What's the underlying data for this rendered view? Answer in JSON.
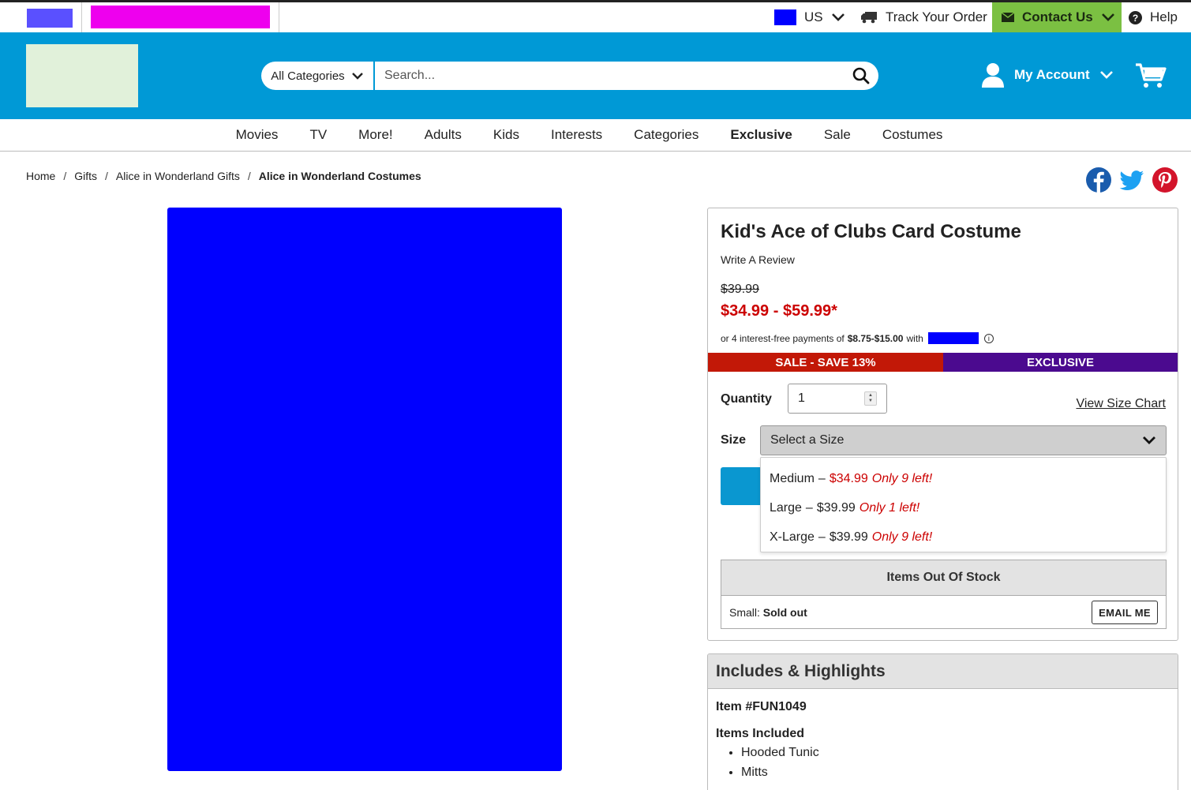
{
  "topbar": {
    "region": "US",
    "track_order": "Track Your Order",
    "contact": "Contact Us",
    "help": "Help"
  },
  "header": {
    "category_select": "All Categories",
    "search_placeholder": "Search...",
    "account": "My Account"
  },
  "nav": {
    "items": [
      "Movies",
      "TV",
      "More!",
      "Adults",
      "Kids",
      "Interests",
      "Categories",
      "Exclusive",
      "Sale",
      "Costumes"
    ]
  },
  "breadcrumb": [
    "Home",
    "Gifts",
    "Alice in Wonderland Gifts",
    "Alice in Wonderland Costumes"
  ],
  "product": {
    "title": "Kid's Ace of Clubs Card Costume",
    "write_review": "Write A Review",
    "old_price": "$39.99",
    "price_range": "$34.99 - $59.99*",
    "installments_prefix": "or 4 interest-free payments of",
    "installments_amount": "$8.75-$15.00",
    "installments_with": "with",
    "ribbon_sale": "SALE - SAVE 13%",
    "ribbon_exclusive": "EXCLUSIVE",
    "quantity_label": "Quantity",
    "quantity_value": "1",
    "size_chart": "View Size Chart",
    "size_label": "Size",
    "size_select": "Select a Size",
    "size_options": [
      {
        "name": "Medium",
        "price": "$34.99",
        "price_red": true,
        "stock": "Only 9 left!"
      },
      {
        "name": "Large",
        "price": "$39.99",
        "price_red": false,
        "stock": "Only 1 left!"
      },
      {
        "name": "X-Large",
        "price": "$39.99",
        "price_red": false,
        "stock": "Only 9 left!"
      }
    ],
    "oos_title": "Items Out Of Stock",
    "oos_size": "Small:",
    "oos_status": "Sold out",
    "email_me": "EMAIL ME"
  },
  "includes": {
    "title": "Includes & Highlights",
    "item_number": "Item #FUN1049",
    "items_included_label": "Items Included",
    "items": [
      "Hooded Tunic",
      "Mitts"
    ]
  },
  "colors": {
    "header_blue": "#0099d6",
    "contact_green": "#7bc042",
    "sale_red": "#c21807",
    "exclusive_purple": "#4b0a8f",
    "price_red": "#cc0000"
  }
}
